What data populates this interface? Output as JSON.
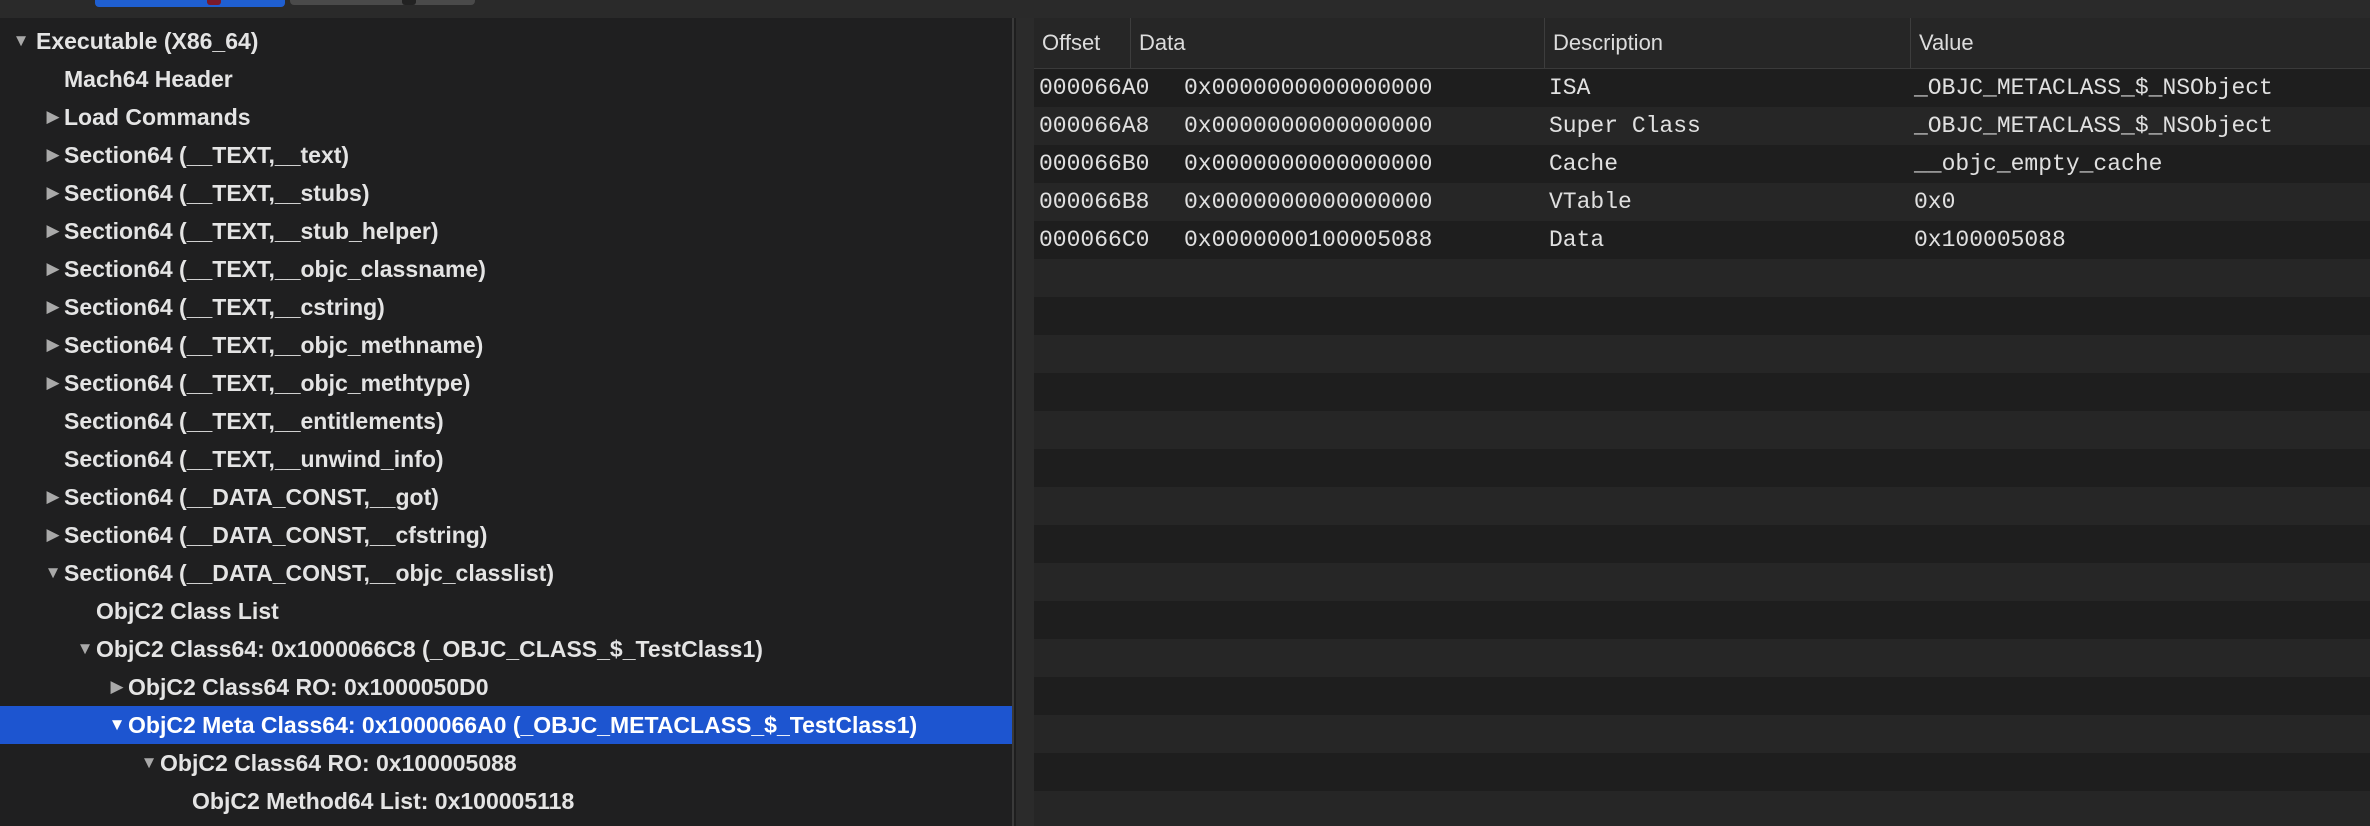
{
  "tree": [
    {
      "label": "Executable (X86_64)",
      "disclosure": "expanded"
    },
    {
      "label": "Mach64 Header",
      "disclosure": "none"
    },
    {
      "label": "Load Commands",
      "disclosure": "collapsed"
    },
    {
      "label": "Section64 (__TEXT,__text)",
      "disclosure": "collapsed"
    },
    {
      "label": "Section64 (__TEXT,__stubs)",
      "disclosure": "collapsed"
    },
    {
      "label": "Section64 (__TEXT,__stub_helper)",
      "disclosure": "collapsed"
    },
    {
      "label": "Section64 (__TEXT,__objc_classname)",
      "disclosure": "collapsed"
    },
    {
      "label": "Section64 (__TEXT,__cstring)",
      "disclosure": "collapsed"
    },
    {
      "label": "Section64 (__TEXT,__objc_methname)",
      "disclosure": "collapsed"
    },
    {
      "label": "Section64 (__TEXT,__objc_methtype)",
      "disclosure": "collapsed"
    },
    {
      "label": "Section64 (__TEXT,__entitlements)",
      "disclosure": "none"
    },
    {
      "label": "Section64 (__TEXT,__unwind_info)",
      "disclosure": "none"
    },
    {
      "label": "Section64 (__DATA_CONST,__got)",
      "disclosure": "collapsed"
    },
    {
      "label": "Section64 (__DATA_CONST,__cfstring)",
      "disclosure": "collapsed"
    },
    {
      "label": "Section64 (__DATA_CONST,__objc_classlist)",
      "disclosure": "expanded"
    },
    {
      "label": "ObjC2 Class List",
      "disclosure": "none"
    },
    {
      "label": "ObjC2 Class64: 0x1000066C8 (_OBJC_CLASS_$_TestClass1)",
      "disclosure": "expanded"
    },
    {
      "label": "ObjC2 Class64 RO: 0x1000050D0",
      "disclosure": "collapsed"
    },
    {
      "label": "ObjC2 Meta Class64: 0x1000066A0 (_OBJC_METACLASS_$_TestClass1)",
      "disclosure": "expanded",
      "selected": true
    },
    {
      "label": "ObjC2 Class64 RO: 0x100005088",
      "disclosure": "expanded"
    },
    {
      "label": "ObjC2 Method64 List: 0x100005118",
      "disclosure": "none"
    }
  ],
  "table": {
    "columns": [
      "Offset",
      "Data",
      "Description",
      "Value"
    ],
    "rows": [
      [
        "000066A0",
        "0x0000000000000000",
        "ISA",
        "_OBJC_METACLASS_$_NSObject"
      ],
      [
        "000066A8",
        "0x0000000000000000",
        "Super Class",
        "_OBJC_METACLASS_$_NSObject"
      ],
      [
        "000066B0",
        "0x0000000000000000",
        "Cache",
        "__objc_empty_cache"
      ],
      [
        "000066B8",
        "0x0000000000000000",
        "VTable",
        "0x0"
      ],
      [
        "000066C0",
        "0x0000000100005088",
        "Data",
        "0x100005088"
      ]
    ]
  },
  "colors": {
    "selection": "#1d55d0",
    "background": "#1e1e1e"
  }
}
